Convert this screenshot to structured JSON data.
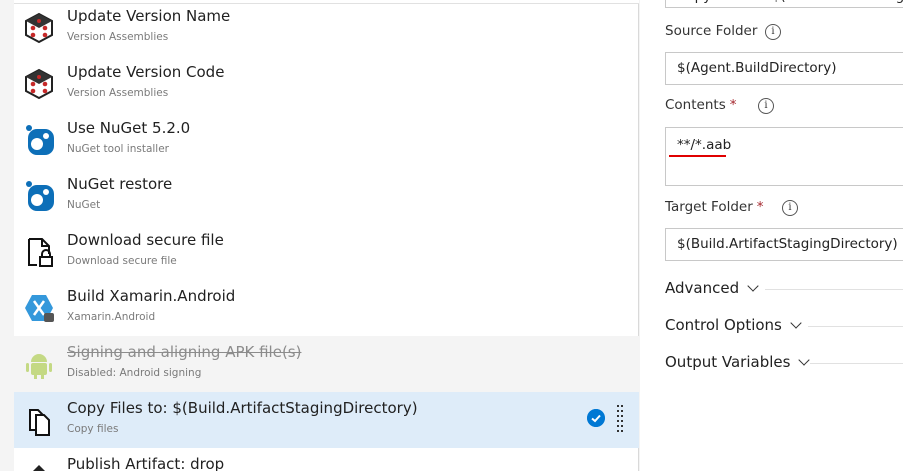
{
  "tasks": [
    {
      "name": "Update Version Name",
      "sub": "Version Assemblies",
      "icon": "version-dice-icon"
    },
    {
      "name": "Update Version Code",
      "sub": "Version Assemblies",
      "icon": "version-dice-icon"
    },
    {
      "name": "Use NuGet 5.2.0",
      "sub": "NuGet tool installer",
      "icon": "nuget-icon"
    },
    {
      "name": "NuGet restore",
      "sub": "NuGet",
      "icon": "nuget-icon"
    },
    {
      "name": "Download secure file",
      "sub": "Download secure file",
      "icon": "secure-file-icon"
    },
    {
      "name": "Build Xamarin.Android",
      "sub": "Xamarin.Android",
      "icon": "xamarin-icon"
    },
    {
      "name": "Signing and aligning APK file(s)",
      "sub": "Disabled: Android signing",
      "icon": "android-icon",
      "disabled": true
    },
    {
      "name": "Copy Files to: $(Build.ArtifactStagingDirectory)",
      "sub": "Copy files",
      "icon": "copy-files-icon",
      "selected": true
    },
    {
      "name": "Publish Artifact: drop",
      "icon": "publish-icon"
    }
  ],
  "form": {
    "display_name_value": "Copy Files to: $(Build.ArtifactStaging",
    "source_folder_label": "Source Folder",
    "source_folder_value": "$(Agent.BuildDirectory)",
    "contents_label": "Contents",
    "contents_value": "**/*.aab",
    "target_folder_label": "Target Folder",
    "target_folder_value": "$(Build.ArtifactStagingDirectory)",
    "required_mark": "*",
    "info_glyph": "i"
  },
  "sections": {
    "advanced": "Advanced",
    "control_options": "Control Options",
    "output_variables": "Output Variables"
  },
  "colors": {
    "accent": "#0078d4",
    "selected_row": "#deecf9",
    "annotation_underline": "#e00000"
  }
}
